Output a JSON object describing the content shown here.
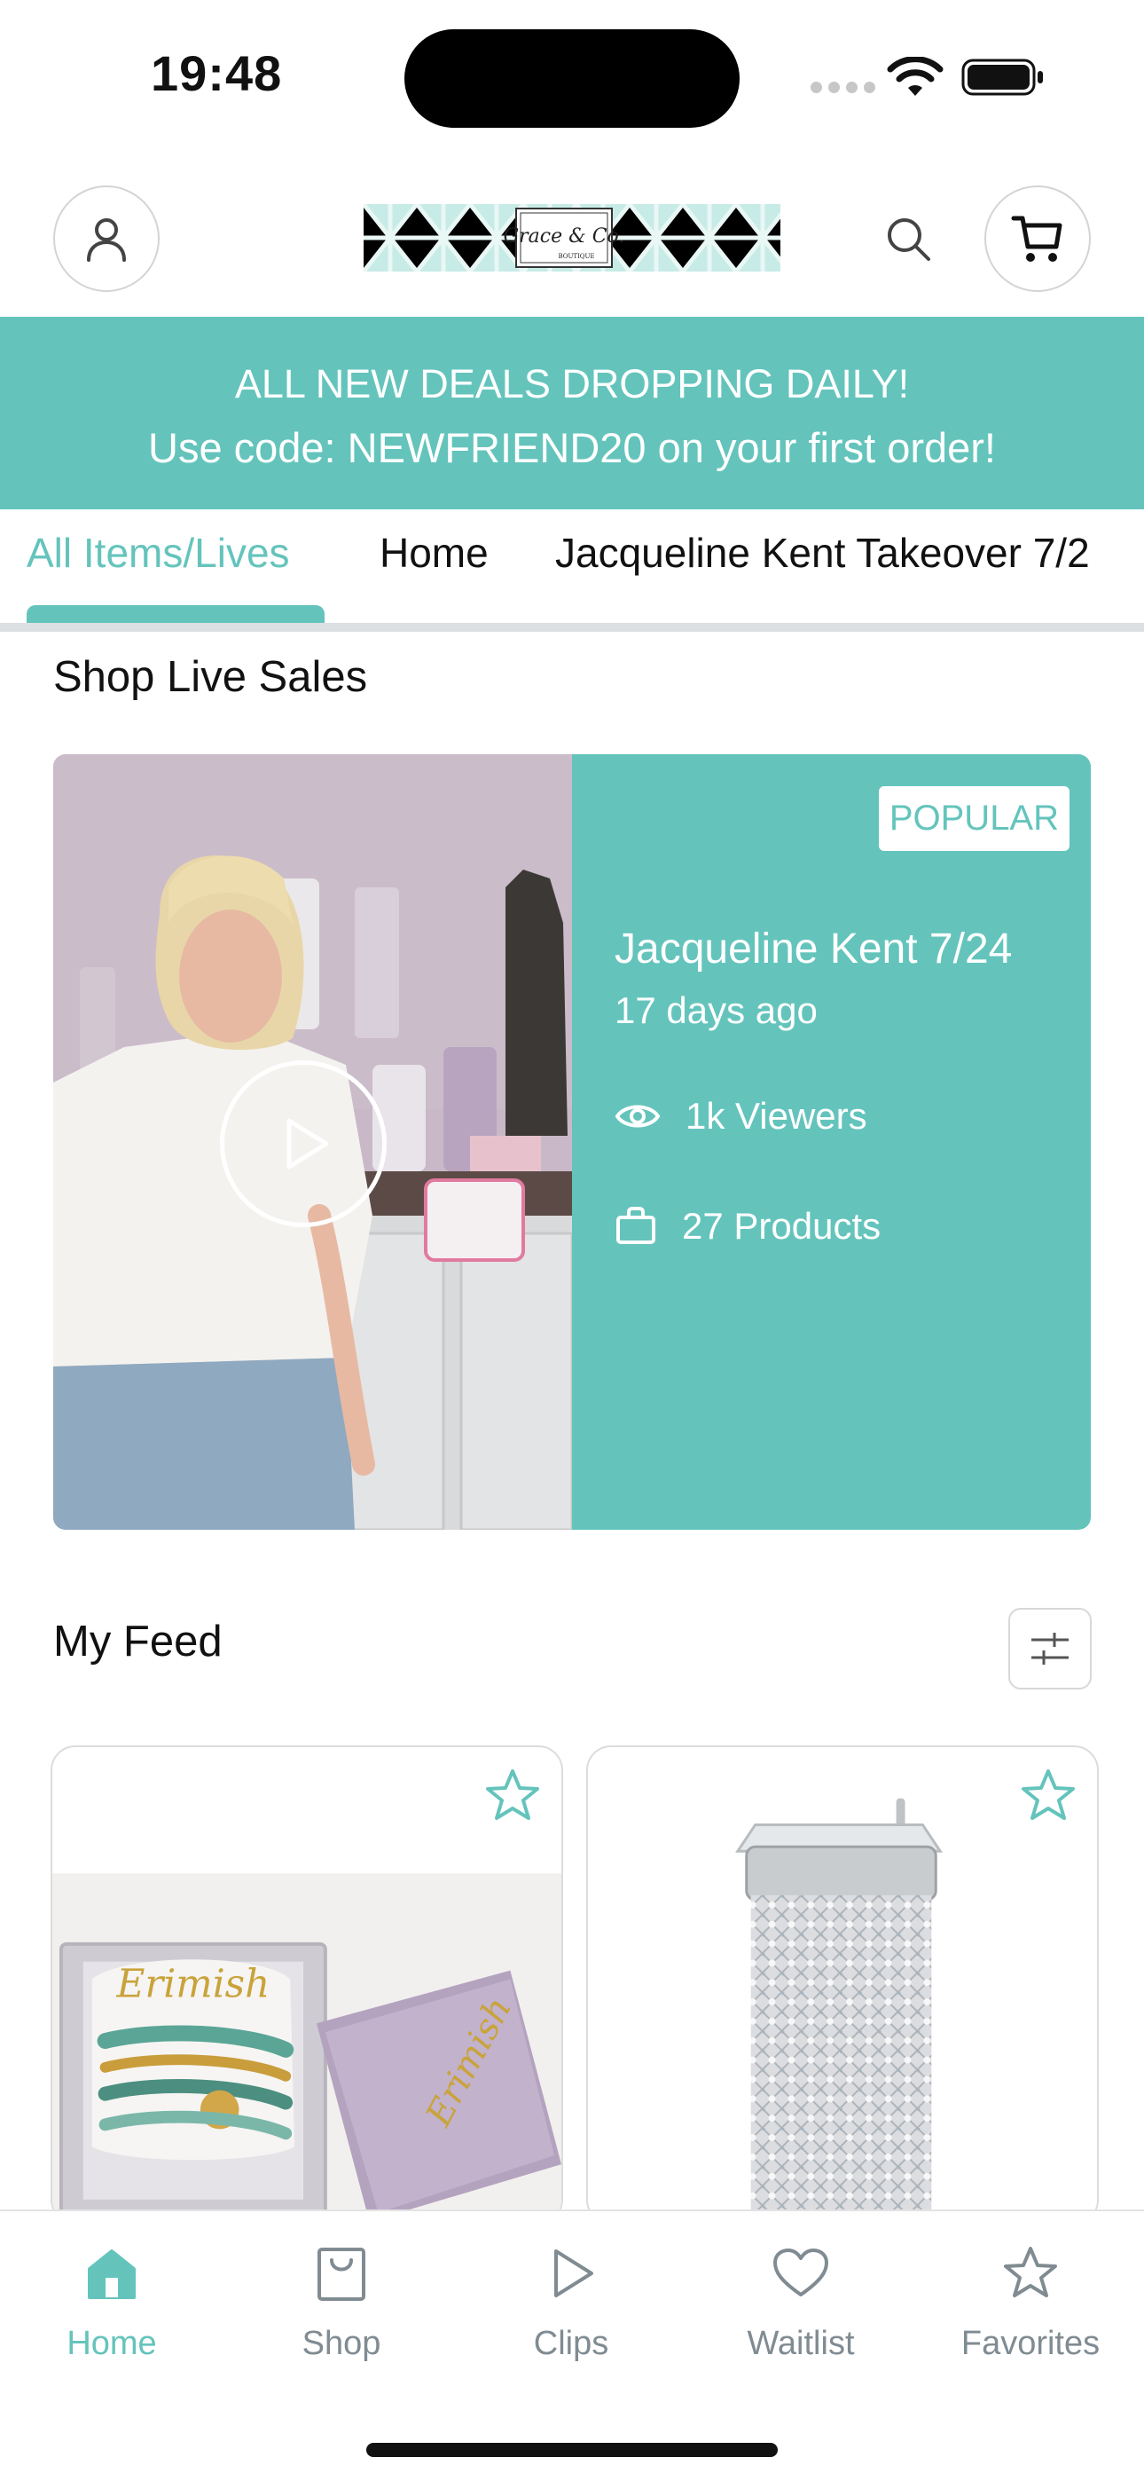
{
  "status_bar": {
    "time": "19:48"
  },
  "header": {
    "logo_text": "Grace & Co.",
    "logo_subtext": "BOUTIQUE"
  },
  "promo": {
    "line1": "ALL NEW DEALS DROPPING DAILY!",
    "line2": "Use code: NEWFRIEND20 on your first order!"
  },
  "tabs": [
    {
      "label": "All Items/Lives",
      "active": true
    },
    {
      "label": "Home",
      "active": false
    },
    {
      "label": "Jacqueline Kent Takeover 7/2",
      "active": false
    }
  ],
  "live_section": {
    "title": "Shop Live Sales",
    "card": {
      "badge": "POPULAR",
      "title": "Jacqueline Kent 7/24",
      "ago": "17 days ago",
      "viewers": "1k Viewers",
      "products": "27 Products"
    }
  },
  "feed": {
    "title": "My Feed",
    "products": [
      {
        "image_text": "Erimish"
      },
      {
        "image_text": ""
      }
    ]
  },
  "bottom_nav": [
    {
      "label": "Home",
      "icon": "home-icon",
      "active": true
    },
    {
      "label": "Shop",
      "icon": "shopping-bag-icon",
      "active": false
    },
    {
      "label": "Clips",
      "icon": "play-icon",
      "active": false
    },
    {
      "label": "Waitlist",
      "icon": "heart-icon",
      "active": false
    },
    {
      "label": "Favorites",
      "icon": "star-icon",
      "active": false
    }
  ],
  "colors": {
    "accent": "#64c4bc",
    "nav_inactive": "#808b92",
    "divider": "#dde0e3"
  }
}
